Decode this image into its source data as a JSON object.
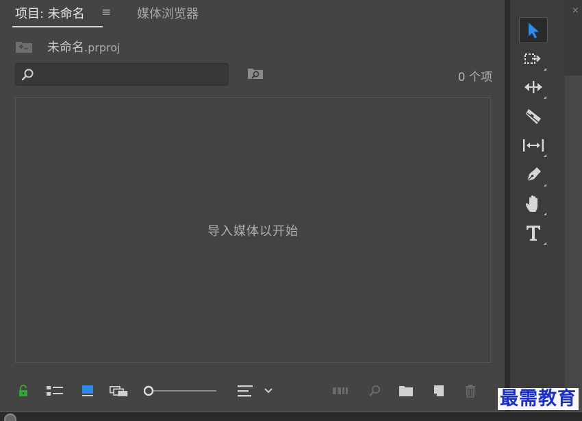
{
  "tabs": {
    "project_label": "项目: 未命名",
    "menu_glyph": "≡",
    "media_browser_label": "媒体浏览器"
  },
  "project": {
    "name": "未命名",
    "extension": ".prproj"
  },
  "search": {
    "value": "",
    "placeholder": ""
  },
  "item_count": "0 个项",
  "media_area": {
    "empty_hint": "导入媒体以开始"
  },
  "bottom_toolbar": {
    "zoom_level": 0,
    "icons": [
      "lock-icon",
      "list-view-icon",
      "icon-view-icon",
      "freeform-view-icon",
      "zoom-slider",
      "sort-icon",
      "automate-icon",
      "find-icon",
      "new-bin-icon",
      "new-item-icon",
      "clear-icon"
    ]
  },
  "tools": [
    "selection-tool",
    "track-select-forward-tool",
    "ripple-edit-tool",
    "razor-tool",
    "slip-tool",
    "pen-tool",
    "hand-tool",
    "type-tool"
  ],
  "colors": {
    "panel_bg": "#444444",
    "accent_blue": "#2d8ceb",
    "lock_green": "#2fa82f",
    "watermark_blue": "#1b2fc4"
  },
  "watermark": {
    "text": "最需教育"
  },
  "right_strip": {
    "close_glyph": "×"
  }
}
